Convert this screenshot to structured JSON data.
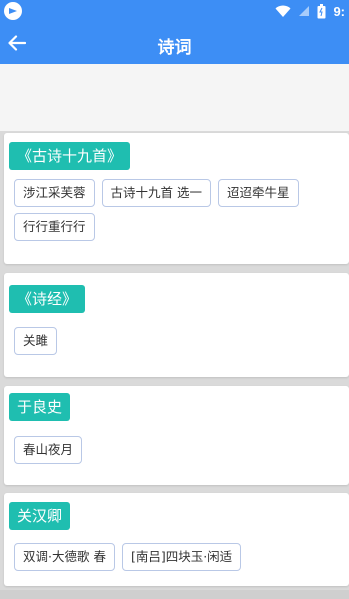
{
  "status_bar": {
    "time": "9:",
    "app_logo_icon": "app-logo-icon",
    "wifi_icon": "wifi-icon",
    "signal_icon": "signal-icon",
    "battery_icon": "battery-icon"
  },
  "header": {
    "title": "诗词",
    "back_icon": "arrow-left-icon"
  },
  "colors": {
    "primary": "#3d8ef5",
    "tag": "#1fbeb0",
    "chip_border": "#b9c8e6"
  },
  "groups": [
    {
      "author": "《古诗十九首》",
      "poems": [
        "涉江采芙蓉",
        "古诗十九首 选一",
        "迢迢牵牛星",
        "行行重行行"
      ]
    },
    {
      "author": "《诗经》",
      "poems": [
        "关雎"
      ]
    },
    {
      "author": "于良史",
      "poems": [
        "春山夜月"
      ]
    },
    {
      "author": "关汉卿",
      "poems": [
        "双调·大德歌 春",
        "[南吕]四块玉·闲适"
      ]
    }
  ]
}
